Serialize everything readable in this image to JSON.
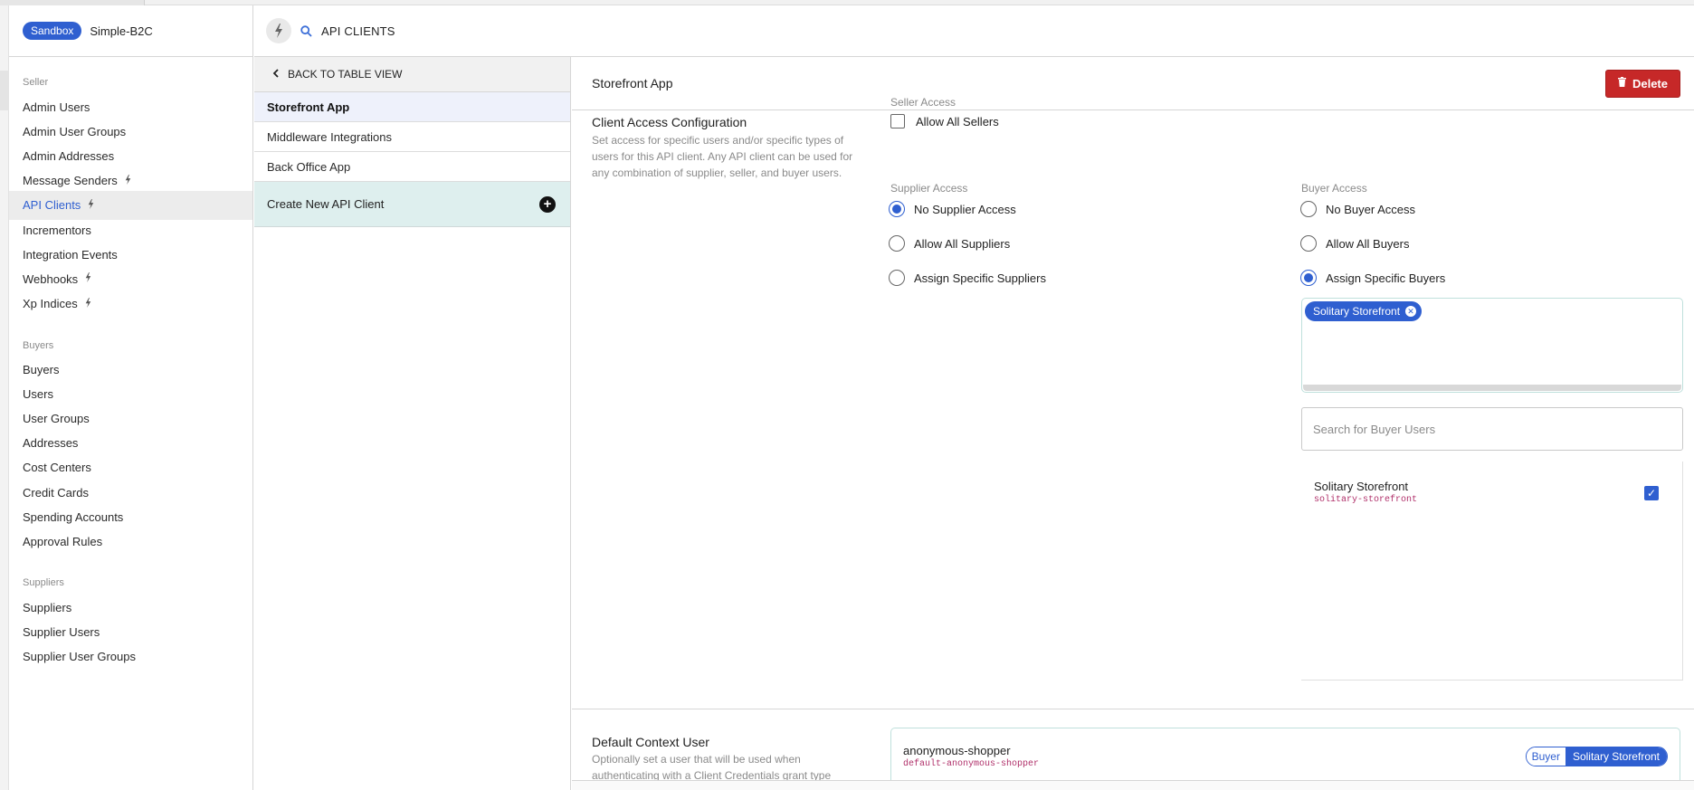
{
  "sidebar": {
    "env_badge": "Sandbox",
    "org_name": "Simple-B2C",
    "sections": [
      {
        "heading": "Seller",
        "items": [
          {
            "label": "Admin Users",
            "bolt": false
          },
          {
            "label": "Admin User Groups",
            "bolt": false
          },
          {
            "label": "Admin Addresses",
            "bolt": false
          },
          {
            "label": "Message Senders",
            "bolt": true
          },
          {
            "label": "API Clients",
            "bolt": true,
            "active": true
          },
          {
            "label": "Incrementors",
            "bolt": false
          },
          {
            "label": "Integration Events",
            "bolt": false
          },
          {
            "label": "Webhooks",
            "bolt": true
          },
          {
            "label": "Xp Indices",
            "bolt": true
          }
        ]
      },
      {
        "heading": "Buyers",
        "items": [
          {
            "label": "Buyers"
          },
          {
            "label": "Users"
          },
          {
            "label": "User Groups"
          },
          {
            "label": "Addresses"
          },
          {
            "label": "Cost Centers"
          },
          {
            "label": "Credit Cards"
          },
          {
            "label": "Spending Accounts"
          },
          {
            "label": "Approval Rules"
          }
        ]
      },
      {
        "heading": "Suppliers",
        "items": [
          {
            "label": "Suppliers"
          },
          {
            "label": "Supplier Users"
          },
          {
            "label": "Supplier User Groups"
          }
        ]
      }
    ]
  },
  "header": {
    "title": "API CLIENTS"
  },
  "list_panel": {
    "back_label": "BACK TO TABLE VIEW",
    "items": [
      "Storefront App",
      "Middleware Integrations",
      "Back Office App"
    ],
    "selected_index": 0,
    "create_label": "Create New API Client"
  },
  "detail": {
    "title": "Storefront App",
    "delete_label": "Delete",
    "config": {
      "title": "Client Access Configuration",
      "description": "Set access for specific users and/or specific types of users for this API client. Any API client can be used for any combination of supplier, seller, and buyer users."
    },
    "seller_access": {
      "label": "Seller Access",
      "checkbox_label": "Allow All Sellers",
      "checked": false
    },
    "supplier_access": {
      "label": "Supplier Access",
      "options": [
        "No Supplier Access",
        "Allow All Suppliers",
        "Assign Specific Suppliers"
      ],
      "selected": 0
    },
    "buyer_access": {
      "label": "Buyer Access",
      "options": [
        "No Buyer Access",
        "Allow All Buyers",
        "Assign Specific Buyers"
      ],
      "selected": 2,
      "assigned_tags": [
        "Solitary Storefront"
      ],
      "search_placeholder": "Search for Buyer Users",
      "results": [
        {
          "name": "Solitary Storefront",
          "id": "solitary-storefront",
          "checked": true
        }
      ]
    },
    "default_context_user": {
      "title": "Default Context User",
      "description": "Optionally set a user that will be used when authenticating with a Client Credentials grant type",
      "user_name": "anonymous-shopper",
      "user_id": "default-anonymous-shopper",
      "badge_type": "Buyer",
      "badge_org": "Solitary Storefront"
    }
  },
  "colors": {
    "accent": "#2f5fd0",
    "danger": "#c62828",
    "create_row_bg": "#deefee",
    "mono_id": "#b0306a"
  }
}
